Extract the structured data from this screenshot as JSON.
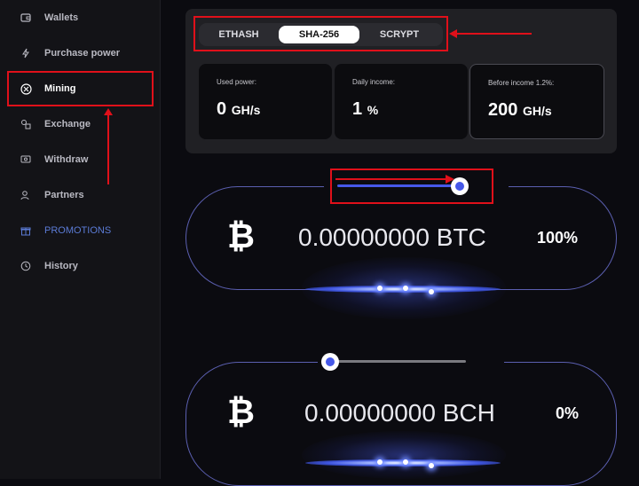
{
  "sidebar": {
    "items": [
      {
        "label": "Wallets",
        "icon": "wallet-icon"
      },
      {
        "label": "Purchase power",
        "icon": "lightning-icon"
      },
      {
        "label": "Mining",
        "icon": "mining-icon"
      },
      {
        "label": "Exchange",
        "icon": "exchange-icon"
      },
      {
        "label": "Withdraw",
        "icon": "withdraw-icon"
      },
      {
        "label": "Partners",
        "icon": "partners-icon"
      },
      {
        "label": "PROMOTIONS",
        "icon": "gift-icon"
      },
      {
        "label": "History",
        "icon": "history-icon"
      }
    ]
  },
  "algorithm_tabs": [
    "ETHASH",
    "SHA-256",
    "SCRYPT"
  ],
  "active_tab": "SHA-256",
  "stats": {
    "used_power": {
      "label": "Used power:",
      "value": "0",
      "unit": "GH/s"
    },
    "daily_income": {
      "label": "Daily income:",
      "value": "1",
      "unit": "%"
    },
    "before_income": {
      "label": "Before income 1.2%:",
      "value": "200",
      "unit": "GH/s"
    }
  },
  "miners": [
    {
      "coin_symbol": "₿",
      "amount": "0.00000000 BTC",
      "percent": "100%",
      "slider_level": 1.0
    },
    {
      "coin_symbol": "₿",
      "amount": "0.00000000 BCH",
      "percent": "0%",
      "slider_level": 0.0
    }
  ],
  "colors": {
    "accent": "#4658e8",
    "highlight": "#e0101a",
    "ring": "#5b5fb0"
  }
}
